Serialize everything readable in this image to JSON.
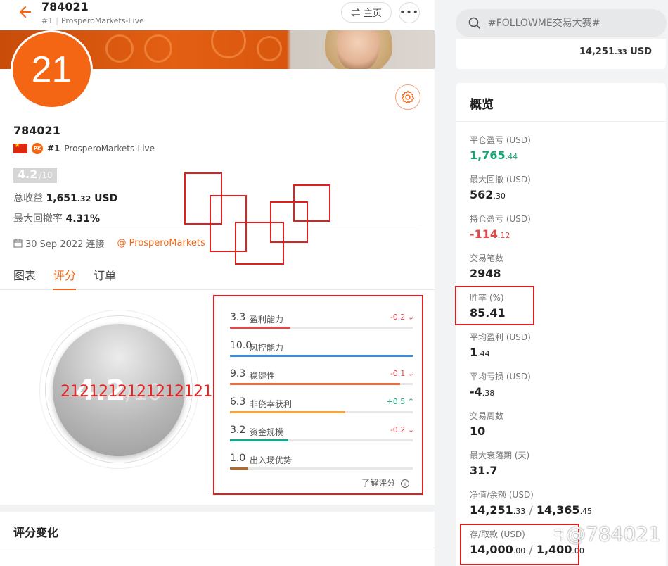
{
  "header": {
    "title": "784021",
    "rank": "#1",
    "broker": "ProsperoMarkets-Live",
    "home_label": "主页"
  },
  "avatar_text": "21",
  "account": {
    "name": "784021",
    "rank": "#1",
    "broker": "ProsperoMarkets-Live",
    "score": "4.2",
    "score_max": "/10",
    "total_profit_label": "总收益",
    "total_profit_int": "1,651",
    "total_profit_dec": ".32",
    "total_profit_unit": " USD",
    "max_dd_label": "最大回撤率",
    "max_dd": "4.31%",
    "since_date": "30 Sep 2022 连接",
    "since_broker": "@ ProsperoMarkets"
  },
  "tabs": [
    {
      "label": "图表"
    },
    {
      "label": "评分"
    },
    {
      "label": "订单"
    }
  ],
  "gauge": {
    "score": "4.2",
    "max": "/10",
    "overlay": "2121212121212121"
  },
  "scores": [
    {
      "value": "3.3",
      "label": "盈利能力",
      "delta": "-0.2",
      "dir": "down",
      "fill": 0.33,
      "color": "#e0484a"
    },
    {
      "value": "10.0",
      "label": "风控能力",
      "delta": "",
      "dir": "",
      "fill": 1.0,
      "color": "#3b8de0"
    },
    {
      "value": "9.3",
      "label": "稳健性",
      "delta": "-0.1",
      "dir": "down",
      "fill": 0.93,
      "color": "#ef6c3c"
    },
    {
      "value": "6.3",
      "label": "非侥幸获利",
      "delta": "+0.5",
      "dir": "up",
      "fill": 0.63,
      "color": "#f2a73e"
    },
    {
      "value": "3.2",
      "label": "资金规模",
      "delta": "-0.2",
      "dir": "down",
      "fill": 0.32,
      "color": "#17a68a"
    },
    {
      "value": "1.0",
      "label": "出入场优势",
      "delta": "",
      "dir": "",
      "fill": 0.1,
      "color": "#b06a2e"
    }
  ],
  "learn_label": "了解评分",
  "change_title": "评分变化",
  "search": {
    "placeholder": "#FOLLOWME交易大赛#"
  },
  "prev_card": {
    "int": "14,251",
    "dec": ".33",
    "unit": " USD"
  },
  "overview": {
    "title": "概览",
    "items": [
      {
        "label": "平仓盈亏 (USD)",
        "int": "1,765",
        "dec": ".44",
        "tone": "green"
      },
      {
        "label": "最大回撤 (USD)",
        "int": "562",
        "dec": ".30",
        "tone": ""
      },
      {
        "label": "持仓盈亏 (USD)",
        "int": "-114",
        "dec": ".12",
        "tone": "red"
      },
      {
        "label": "交易笔数",
        "int": "2948",
        "dec": "",
        "tone": ""
      },
      {
        "label": "胜率 (%)",
        "int": "85.41",
        "dec": "",
        "tone": ""
      },
      {
        "label": "平均盈利 (USD)",
        "int": "1",
        "dec": ".44",
        "tone": ""
      },
      {
        "label": "平均亏损 (USD)",
        "int": "-4",
        "dec": ".38",
        "tone": ""
      },
      {
        "label": "交易周数",
        "int": "10",
        "dec": "",
        "tone": ""
      },
      {
        "label": "最大衰落期 (天)",
        "int": "31.7",
        "dec": "",
        "tone": ""
      },
      {
        "label": "净值/余额 (USD)",
        "int": "14,251",
        "dec": ".33",
        "int2": "14,365",
        "dec2": ".45",
        "tone": ""
      },
      {
        "label": "存/取款 (USD)",
        "int": "14,000",
        "dec": ".00",
        "int2": "1,400",
        "dec2": ".00",
        "tone": ""
      }
    ]
  },
  "watermark": "@784021",
  "colors": {
    "accent": "#f56614",
    "green": "#17a673",
    "red": "#e0484a"
  }
}
